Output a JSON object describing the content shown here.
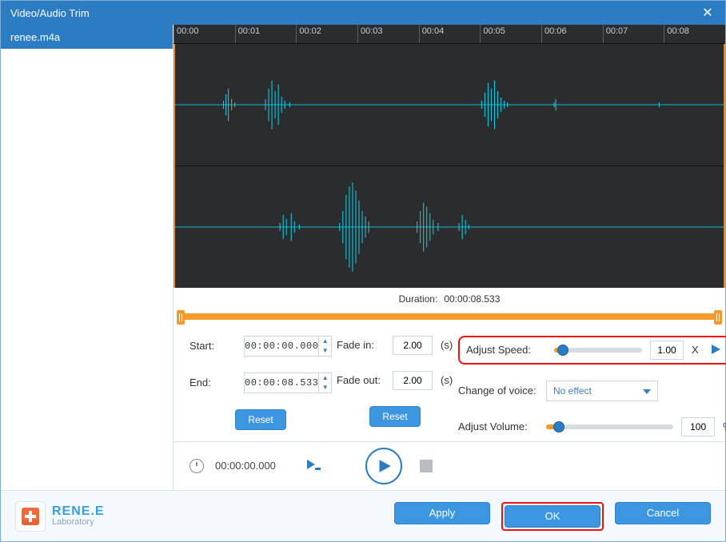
{
  "window": {
    "title": "Video/Audio Trim"
  },
  "sidebar": {
    "items": [
      "renee.m4a"
    ]
  },
  "ruler": {
    "ticks": [
      "00:00",
      "00:01",
      "00:02",
      "00:03",
      "00:04",
      "00:05",
      "00:06",
      "00:07",
      "00:08"
    ]
  },
  "duration": {
    "label": "Duration:",
    "value": "00:00:08.533"
  },
  "trim": {
    "start_label": "Start:",
    "start_value": "00:00:00.000",
    "end_label": "End:",
    "end_value": "00:00:08.533",
    "reset_label": "Reset"
  },
  "fade": {
    "in_label": "Fade in:",
    "in_value": "2.00",
    "out_label": "Fade out:",
    "out_value": "2.00",
    "unit": "(s)",
    "reset_label": "Reset"
  },
  "speed": {
    "label": "Adjust Speed:",
    "value": "1.00",
    "unit": "X",
    "slider_percent": 10
  },
  "voice": {
    "label": "Change of voice:",
    "value": "No effect"
  },
  "volume": {
    "label": "Adjust Volume:",
    "value": "100",
    "unit": "%",
    "slider_percent": 10
  },
  "playback": {
    "time": "00:00:00.000"
  },
  "brand": {
    "name": "RENE.E",
    "sub": "Laboratory"
  },
  "footer": {
    "apply": "Apply",
    "ok": "OK",
    "cancel": "Cancel"
  }
}
